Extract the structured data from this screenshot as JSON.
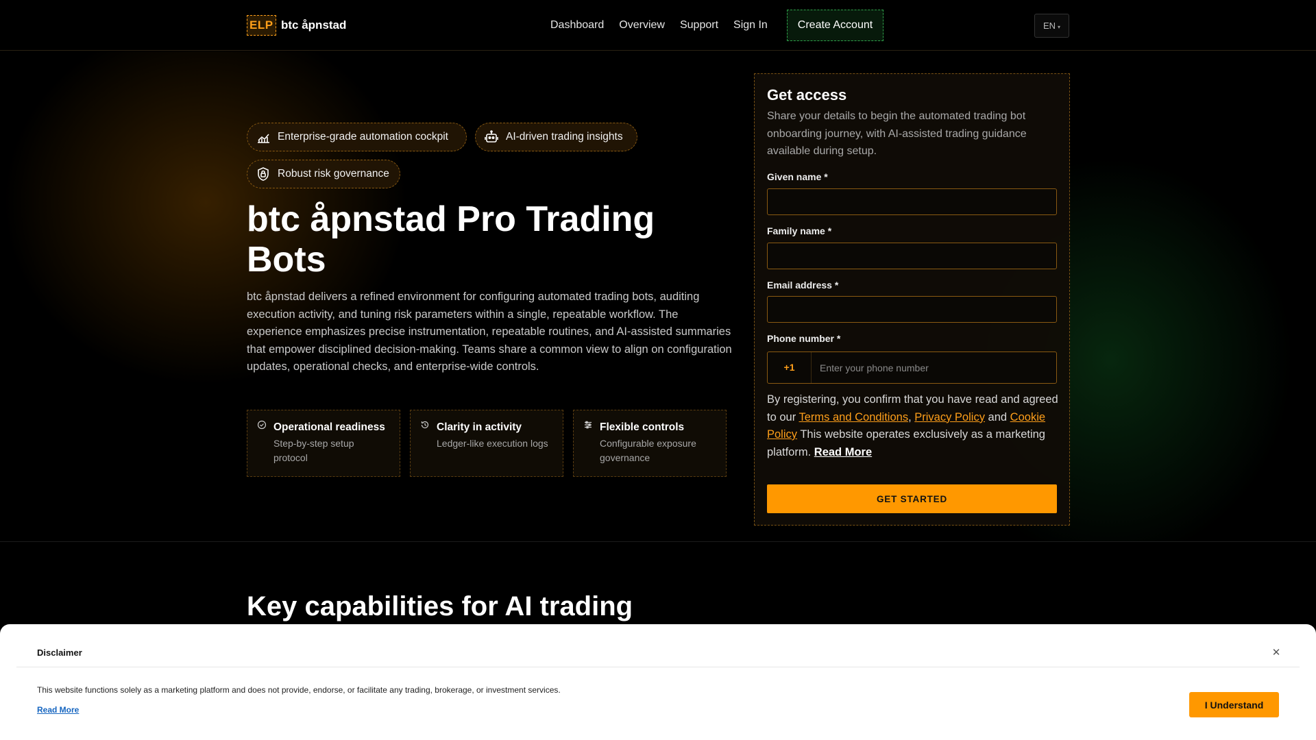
{
  "header": {
    "logo": "ELP",
    "brand": "btc åpnstad",
    "nav": [
      "Dashboard",
      "Overview",
      "Support",
      "Sign In"
    ],
    "create_account": "Create Account",
    "language": "EN"
  },
  "hero": {
    "pills": [
      {
        "label": "Enterprise-grade automation cockpit",
        "icon": "chart-icon"
      },
      {
        "label": "AI-driven trading insights",
        "icon": "robot-icon"
      },
      {
        "label": "Robust risk governance",
        "icon": "shield-icon"
      }
    ],
    "title": "btc åpnstad Pro Trading Bots",
    "description": "btc åpnstad delivers a refined environment for configuring automated trading bots, auditing execution activity, and tuning risk parameters within a single, repeatable workflow. The experience emphasizes precise instrumentation, repeatable routines, and AI-assisted summaries that empower disciplined decision-making. Teams share a common view to align on configuration updates, operational checks, and enterprise-wide controls.",
    "features": [
      {
        "title": "Operational readiness",
        "subtitle": "Step-by-step setup protocol",
        "icon": "check-circle-icon"
      },
      {
        "title": "Clarity in activity",
        "subtitle": "Ledger-like execution logs",
        "icon": "history-icon"
      },
      {
        "title": "Flexible controls",
        "subtitle": "Configurable exposure governance",
        "icon": "sliders-icon"
      }
    ]
  },
  "form": {
    "title": "Get access",
    "subtitle": "Share your details to begin the automated trading bot onboarding journey, with AI-assisted trading guidance available during setup.",
    "given_name_label": "Given name *",
    "family_name_label": "Family name *",
    "email_label": "Email address *",
    "phone_label": "Phone number *",
    "phone_code": "+1",
    "phone_placeholder": "Enter your phone number",
    "legal_prefix": "By registering, you confirm that you have read and agreed to our",
    "terms": "Terms and Conditions",
    "privacy": "Privacy Policy",
    "and": "and",
    "cookie": "Cookie Policy",
    "legal_suffix": "This website operates exclusively as a marketing platform.",
    "read_more": "Read More",
    "submit": "GET STARTED"
  },
  "section2": {
    "title": "Key capabilities for AI trading"
  },
  "disclaimer": {
    "title": "Disclaimer",
    "text": "This website functions solely as a marketing platform and does not provide, endorse, or facilitate any trading, brokerage, or investment services.",
    "read_more": "Read More",
    "button": "I Understand"
  },
  "colors": {
    "accent": "#ff9800",
    "create_border": "#2fa14a",
    "link_blue": "#1565c0"
  }
}
